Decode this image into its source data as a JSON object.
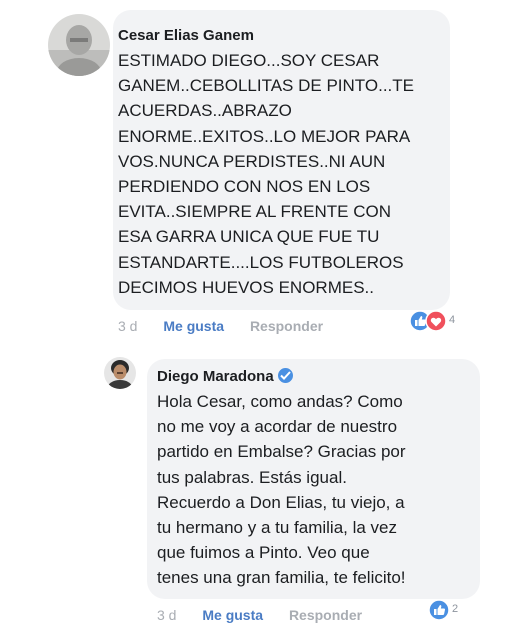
{
  "comment": {
    "author": "Cesar Elias Ganem",
    "lines": [
      "ESTIMADO DIEGO...SOY CESAR",
      "GANEM..CEBOLLITAS DE PINTO...TE",
      "ACUERDAS..ABRAZO",
      "ENORME..EXITOS..LO MEJOR PARA",
      "VOS.NUNCA PERDISTES..NI AUN",
      "PERDIENDO CON NOS EN LOS",
      "EVITA..SIEMPRE AL FRENTE CON",
      "ESA GARRA UNICA QUE FUE TU",
      "ESTANDARTE....LOS FUTBOLEROS",
      "DECIMOS HUEVOS ENORMES.."
    ],
    "time": "3 d",
    "like_label": "Me gusta",
    "reply_label": "Responder",
    "reactions": [
      "like-icon",
      "love-icon"
    ],
    "reaction_count": "4"
  },
  "reply": {
    "author": "Diego Maradona",
    "verified": "verified-badge-icon",
    "lines": [
      "Hola Cesar, como andas? Como",
      "no me voy a acordar de nuestro",
      "partido en Embalse? Gracias por",
      "tus palabras. Estás igual.",
      "Recuerdo a Don Elias, tu viejo, a",
      "tu hermano y a tu familia, la vez",
      "que fuimos a Pinto. Veo que",
      "tenes una gran familia, te felicito!"
    ],
    "time": "3 d",
    "like_label": "Me gusta",
    "reply_label": "Responder",
    "reactions": [
      "like-icon"
    ],
    "reaction_count": "2"
  },
  "colors": {
    "bubble": "#f2f3f5",
    "link": "#4a7cc4",
    "muted": "#a9adb3",
    "like_blue": "#4a90e2",
    "love_red": "#f0505c"
  }
}
